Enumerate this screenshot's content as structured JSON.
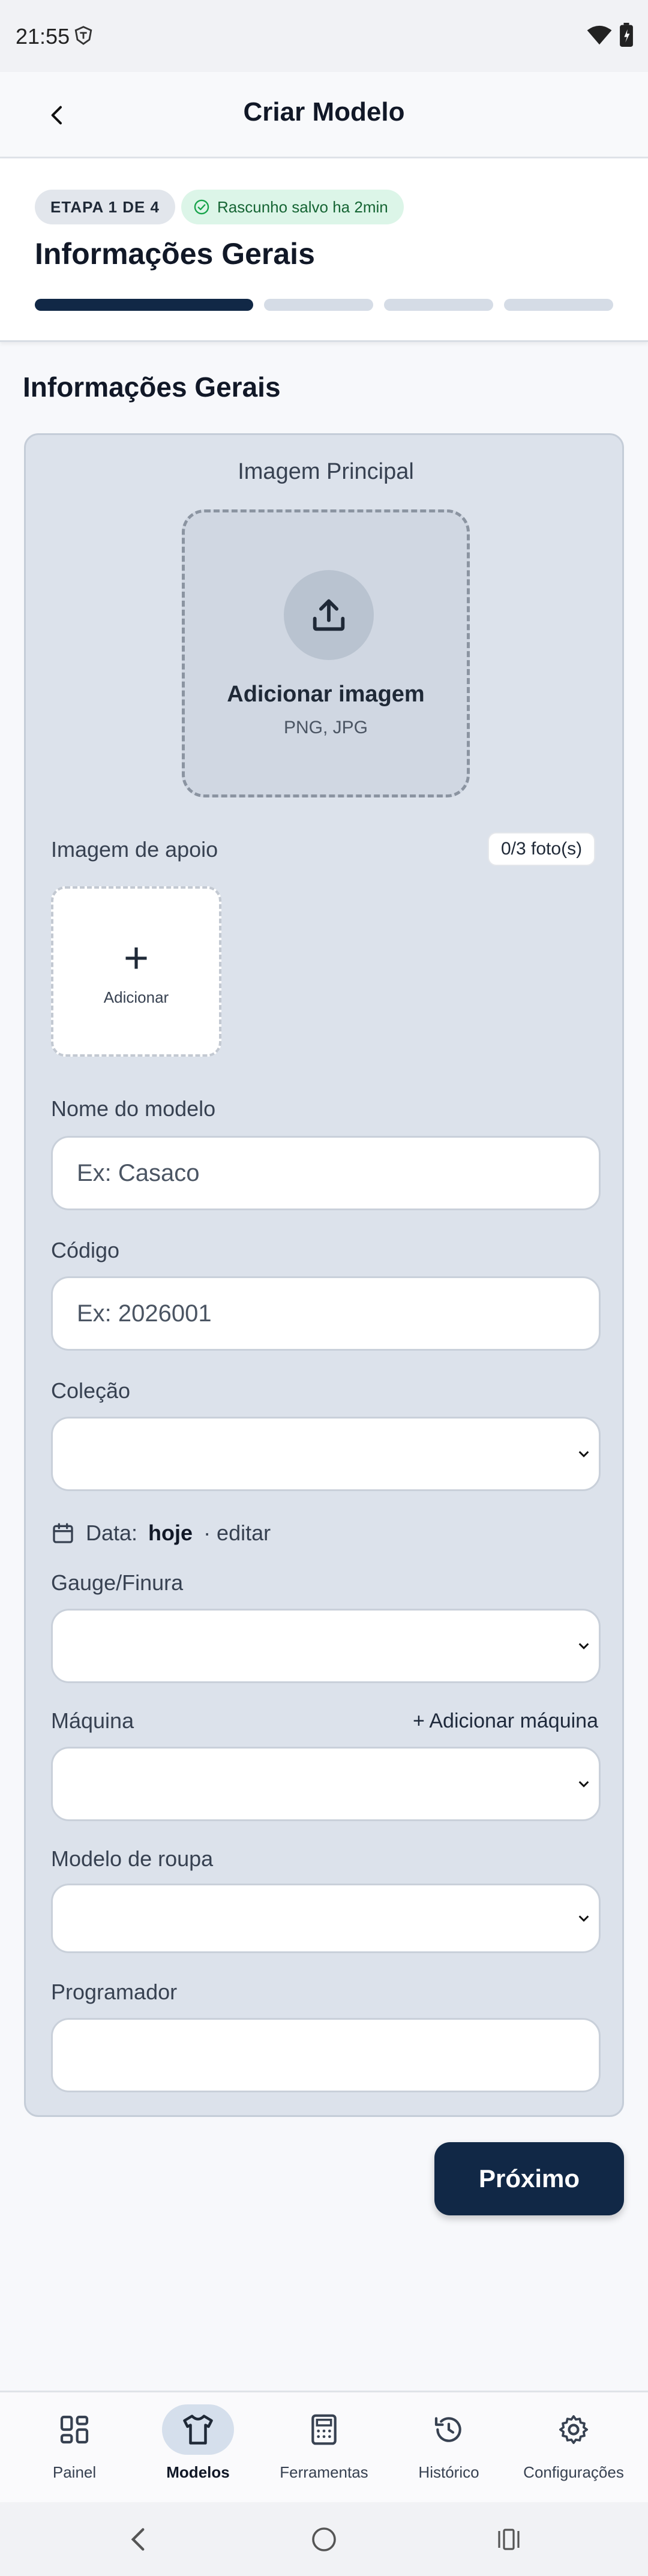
{
  "status_bar": {
    "time": "21:55"
  },
  "app_bar": {
    "title": "Criar Modelo"
  },
  "steps": {
    "badge": "ETAPA 1 DE 4",
    "draft_status": "Rascunho salvo ha 2min",
    "heading": "Informações Gerais",
    "total": 4,
    "current": 1
  },
  "form": {
    "section_title": "Informações Gerais",
    "main_image": {
      "label": "Imagem Principal",
      "action": "Adicionar imagem",
      "formats": "PNG, JPG"
    },
    "support_image": {
      "label": "Imagem de apoio",
      "count": "0/3 foto(s)",
      "add_label": "Adicionar"
    },
    "model_name": {
      "label": "Nome do modelo",
      "value": "",
      "placeholder": "Ex: Casaco"
    },
    "code": {
      "label": "Código",
      "value": "",
      "placeholder": "Ex: 2026001"
    },
    "collection": {
      "label": "Coleção",
      "value": ""
    },
    "date": {
      "prefix": "Data:",
      "value": "hoje",
      "edit": "· editar"
    },
    "gauge": {
      "label": "Gauge/Finura",
      "value": ""
    },
    "machine": {
      "label": "Máquina",
      "value": "",
      "add_action": "+ Adicionar máquina"
    },
    "garment_model": {
      "label": "Modelo de roupa",
      "value": ""
    },
    "programmer": {
      "label": "Programador",
      "value": "",
      "placeholder": ""
    }
  },
  "actions": {
    "next": "Próximo"
  },
  "bottom_nav": {
    "items": [
      {
        "label": "Painel",
        "icon": "dashboard-icon"
      },
      {
        "label": "Modelos",
        "icon": "shirt-icon",
        "active": true
      },
      {
        "label": "Ferramentas",
        "icon": "calculator-icon"
      },
      {
        "label": "Histórico",
        "icon": "history-icon"
      },
      {
        "label": "Configurações",
        "icon": "gear-icon"
      }
    ]
  },
  "colors": {
    "primary": "#112846",
    "card_bg": "#dce2eb",
    "progress_active": "#112846",
    "progress_inactive": "#d5dce6",
    "draft_badge_bg": "#dcf5e8",
    "draft_badge_text": "#166534"
  }
}
